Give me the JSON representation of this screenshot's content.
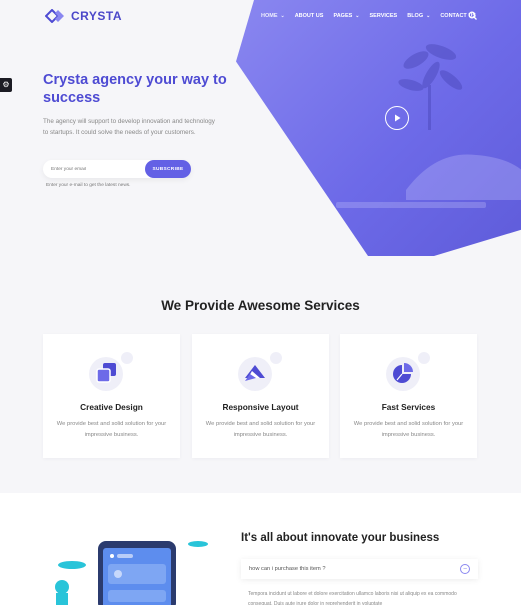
{
  "brand": {
    "name": "CRYSTA",
    "color": "#4e4bd3"
  },
  "nav": {
    "items": [
      {
        "label": "HOME",
        "caret": true
      },
      {
        "label": "ABOUT US",
        "caret": false
      },
      {
        "label": "PAGES",
        "caret": true
      },
      {
        "label": "SERVICES",
        "caret": false
      },
      {
        "label": "BLOG",
        "caret": true
      },
      {
        "label": "CONTACT US",
        "caret": false
      }
    ],
    "search_icon": "search-icon"
  },
  "hero": {
    "title": "Crysta agency your way to success",
    "description": "The agency will support to develop innovation and technology to startups. It could solve the needs of your customers.",
    "email_placeholder": "Enter your email",
    "subscribe_label": "SUBSCRIBE",
    "email_hint": "Enter your e-mail to get the latest news."
  },
  "services": {
    "title": "We Provide Awesome Services",
    "cards": [
      {
        "title": "Creative Design",
        "desc": "We provide best and solid solution for your impressive business.",
        "icon": "layers-icon"
      },
      {
        "title": "Responsive Layout",
        "desc": "We provide best and solid solution for your impressive business.",
        "icon": "triangle-logo-icon"
      },
      {
        "title": "Fast Services",
        "desc": "We provide best and solid solution for your impressive business.",
        "icon": "pie-chart-icon"
      }
    ]
  },
  "innovate": {
    "title": "It's all about innovate your business",
    "faq_question": "how can i purchase this item ?",
    "faq_answer": "Tempora incidunt ut labore et dolore exercitation ullamco laboris nisi ut aliquip ex ea commodo consequat. Duis aute irure dolor in reprehenderit in voluptate"
  },
  "colors": {
    "accent": "#6360e5",
    "blob": "#7471ea",
    "icon_bg": "#efeff8"
  }
}
